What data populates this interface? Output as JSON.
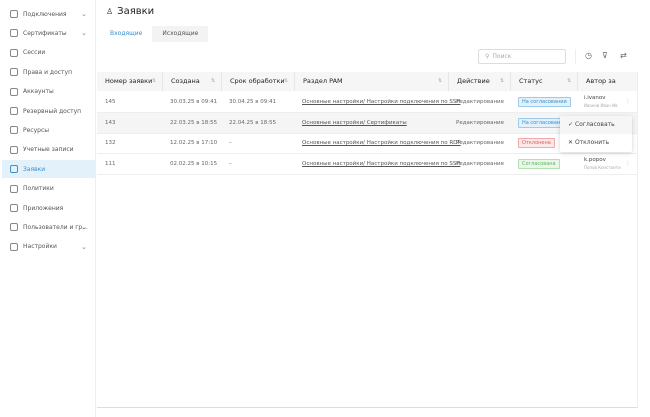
{
  "sidebar": {
    "items": [
      {
        "label": "Подключения",
        "icon": "connections-icon",
        "chevron": true
      },
      {
        "label": "Сертификаты",
        "icon": "certificate-icon",
        "chevron": true
      },
      {
        "label": "Сессии",
        "icon": "video-icon",
        "chevron": false
      },
      {
        "label": "Права и доступ",
        "icon": "calendar-icon",
        "chevron": false
      },
      {
        "label": "Аккаунты",
        "icon": "accounts-icon",
        "chevron": false
      },
      {
        "label": "Резервный доступ",
        "icon": "backup-icon",
        "chevron": false
      },
      {
        "label": "Ресурсы",
        "icon": "resources-icon",
        "chevron": false
      },
      {
        "label": "Учетные записи",
        "icon": "key-icon",
        "chevron": false
      },
      {
        "label": "Заявки",
        "icon": "requests-icon",
        "chevron": false,
        "active": true
      },
      {
        "label": "Политики",
        "icon": "policy-icon",
        "chevron": false
      },
      {
        "label": "Приложения",
        "icon": "apps-icon",
        "chevron": false
      },
      {
        "label": "Пользователи и гр...",
        "icon": "users-icon",
        "chevron": true
      },
      {
        "label": "Настройки",
        "icon": "gear-icon",
        "chevron": true
      }
    ]
  },
  "header": {
    "title": "Заявки"
  },
  "tabs": [
    {
      "label": "Входящие",
      "active": true
    },
    {
      "label": "Исходящие",
      "active": false
    }
  ],
  "search": {
    "placeholder": "Поиск"
  },
  "table": {
    "columns": [
      "Номер заявки",
      "Создана",
      "Срок обработки",
      "Раздел PAM",
      "Действие",
      "Статус",
      "Автор за"
    ],
    "rows": [
      {
        "id": "145",
        "created": "30.03.25 в 09:41",
        "deadline": "30.04.25 в 09:41",
        "section": "Основные настройки/ Настройки подключения по SSH",
        "action": "Редактирование",
        "status": "На согласовании",
        "status_type": "pending",
        "author_login": "i.ivanov",
        "author_name": "Иванов Иван Ив"
      },
      {
        "id": "143",
        "created": "22.03.25 в 18:55",
        "deadline": "22.04.25 в 18:55",
        "section": "Основные настройки/ Сертификаты",
        "action": "Редактирование",
        "status": "На согласовании",
        "status_type": "pending",
        "author_login": "",
        "author_name": ""
      },
      {
        "id": "132",
        "created": "12.02.25 в 17:10",
        "deadline": "–",
        "section": "Основные настройки/ Настройки подключения по RDP",
        "action": "Редактирование",
        "status": "Отклонена",
        "status_type": "rejected",
        "author_login": "",
        "author_name": ""
      },
      {
        "id": "111",
        "created": "02.02.25 в 10:15",
        "deadline": "–",
        "section": "Основные настройки/ Настройки подключения по SSH",
        "action": "Редактирование",
        "status": "Согласована",
        "status_type": "approved",
        "author_login": "k.popov",
        "author_name": "Попов Константи"
      }
    ]
  },
  "context_menu": {
    "approve": "Согласовать",
    "reject": "Отклонить"
  },
  "colors": {
    "accent": "#3a8fd0",
    "pending": "#3a8fd0",
    "rejected": "#e05a5a",
    "approved": "#5cb85c"
  }
}
